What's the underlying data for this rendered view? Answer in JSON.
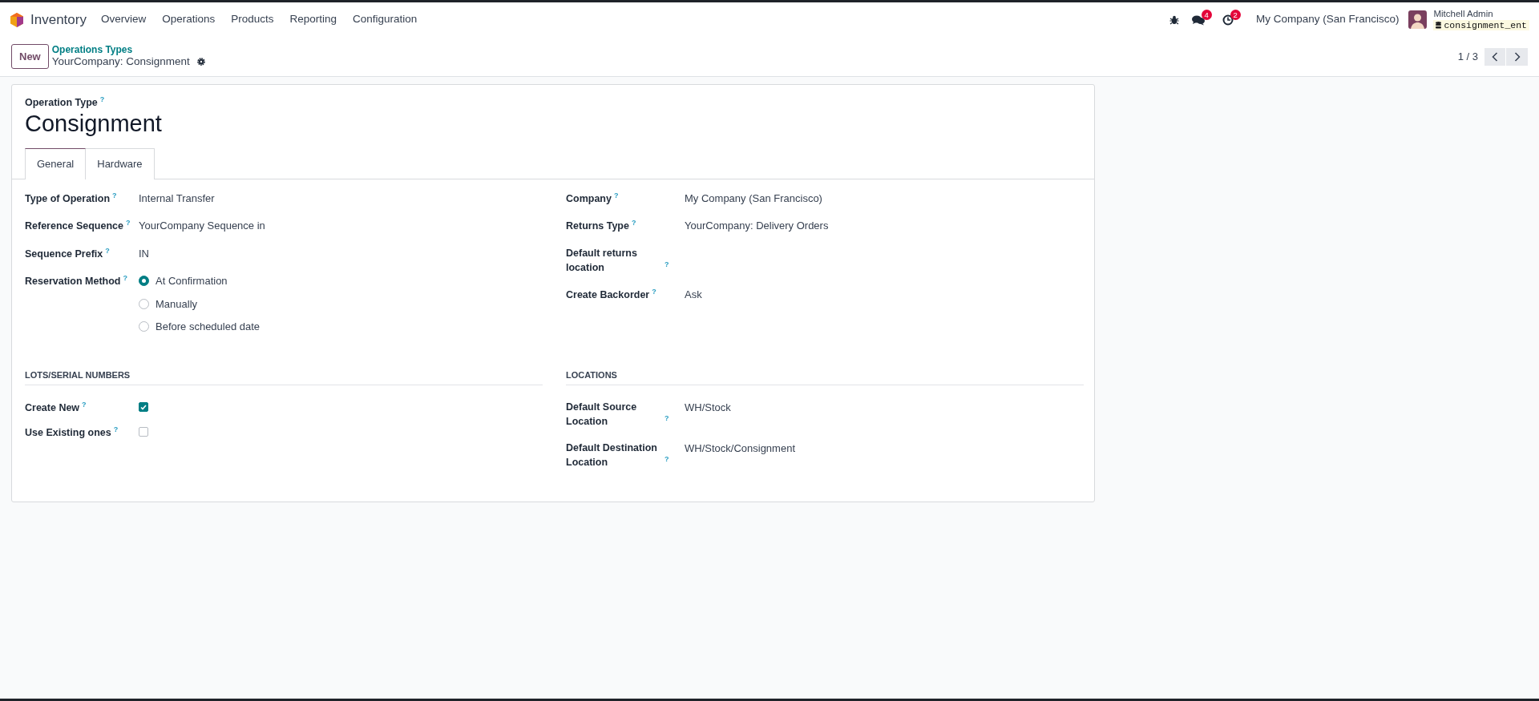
{
  "navbar": {
    "app_name": "Inventory",
    "menu": [
      "Overview",
      "Operations",
      "Products",
      "Reporting",
      "Configuration"
    ],
    "messages_badge": "4",
    "activities_badge": "2",
    "company": "My Company (San Francisco)",
    "user_name": "Mitchell Admin",
    "database": "consignment_ent"
  },
  "control_panel": {
    "new_button": "New",
    "breadcrumb_parent": "Operations Types",
    "breadcrumb_current": "YourCompany: Consignment",
    "pager": "1 / 3"
  },
  "form": {
    "title_label": "Operation Type",
    "title_help": "?",
    "title": "Consignment",
    "tabs": [
      {
        "label": "General",
        "selected": true
      },
      {
        "label": "Hardware",
        "selected": false
      }
    ],
    "left_fields": [
      {
        "label": "Type of Operation",
        "help": "?",
        "kind": "text",
        "value": "Internal Transfer"
      },
      {
        "label": "Reference Sequence",
        "help": "?",
        "kind": "text",
        "value": "YourCompany Sequence in"
      },
      {
        "label": "Sequence Prefix",
        "help": "?",
        "kind": "text",
        "value": "IN"
      },
      {
        "label": "Reservation Method",
        "help": "?",
        "kind": "radio",
        "options": [
          {
            "label": "At Confirmation",
            "selected": true
          },
          {
            "label": "Manually",
            "selected": false
          },
          {
            "label": "Before scheduled date",
            "selected": false
          }
        ]
      }
    ],
    "right_fields": [
      {
        "label": "Company",
        "help": "?",
        "kind": "text",
        "value": "My Company (San Francisco)"
      },
      {
        "label": "Returns Type",
        "help": "?",
        "kind": "text",
        "value": "YourCompany: Delivery Orders"
      },
      {
        "label": "Default returns location",
        "help": "?",
        "kind": "text"
      },
      {
        "label": "Create Backorder",
        "help": "?",
        "kind": "text",
        "value": "Ask"
      }
    ],
    "sections": [
      {
        "title": "LOTS/SERIAL NUMBERS",
        "fields": [
          {
            "label": "Create New",
            "help": "?",
            "kind": "checkbox",
            "checked": true
          },
          {
            "label": "Use Existing ones",
            "help": "?",
            "kind": "checkbox",
            "checked": false
          }
        ]
      },
      {
        "title": "LOCATIONS",
        "fields": [
          {
            "label": "Default Source Location",
            "help": "?",
            "kind": "text",
            "value": "WH/Stock"
          },
          {
            "label": "Default Destination Location",
            "help": "?",
            "kind": "text",
            "value": "WH/Stock/Consignment"
          }
        ]
      }
    ]
  }
}
